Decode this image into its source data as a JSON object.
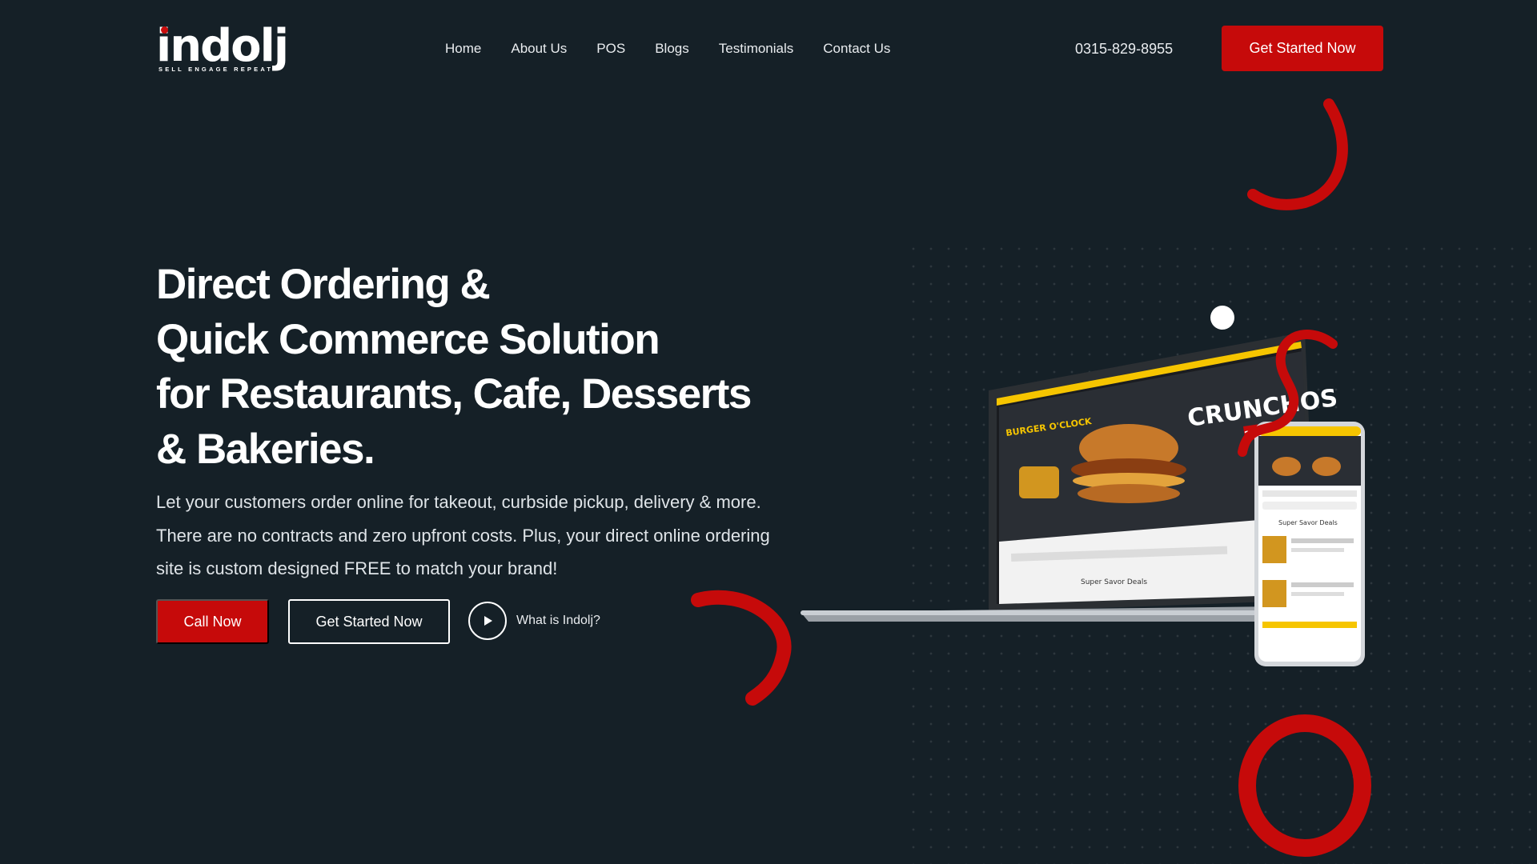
{
  "brand": {
    "logo_text": "indolj",
    "tagline": "SELL ENGAGE REPEAT",
    "accent_color": "#c60a0a",
    "background_color": "#152027"
  },
  "nav": {
    "items": [
      {
        "label": "Home"
      },
      {
        "label": "About Us"
      },
      {
        "label": "POS"
      },
      {
        "label": "Blogs"
      },
      {
        "label": "Testimonials"
      },
      {
        "label": "Contact Us"
      }
    ],
    "phone": "0315-829-8955",
    "cta_label": "Get Started Now"
  },
  "hero": {
    "title_lines": [
      "Direct Ordering &",
      "Quick Commerce Solution",
      "for Restaurants, Cafe, Desserts",
      "& Bakeries."
    ],
    "description": "Let your customers order online for takeout, curbside pickup, delivery & more. There are no contracts and zero upfront costs. Plus, your direct online ordering site is custom designed FREE to match your brand!",
    "call_label": "Call Now",
    "get_started_label": "Get Started Now",
    "video_label": "What is Indolj?"
  },
  "mockup": {
    "laptop_brand": "BURGER O'CLOCK",
    "laptop_headline": "CRUNCHOS",
    "laptop_price": "250",
    "laptop_section": "Super Savor Deals",
    "phone_section": "Super Savor Deals",
    "icons": [
      "play-icon",
      "laptop-icon",
      "phone-icon"
    ]
  }
}
